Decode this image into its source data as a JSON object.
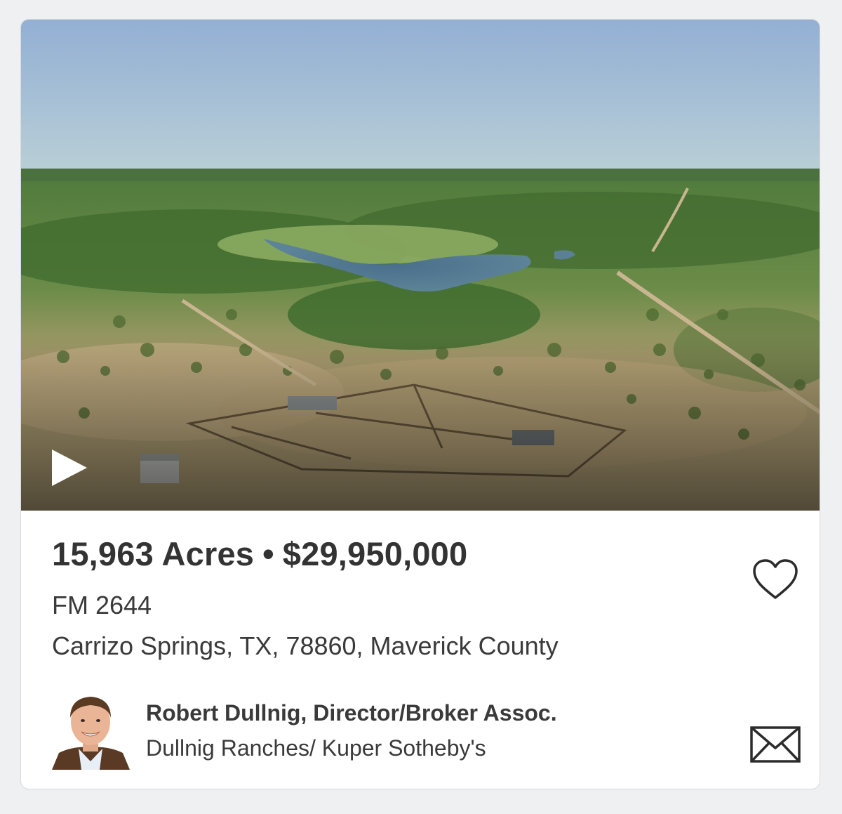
{
  "listing": {
    "acres": "15,963 Acres",
    "separator": "•",
    "price": "$29,950,000",
    "street": "FM 2644",
    "city_line": "Carrizo Springs, TX, 78860, Maverick County"
  },
  "agent": {
    "name": "Robert Dullnig, Director/Broker Assoc.",
    "company": "Dullnig Ranches/ Kuper Sotheby's"
  },
  "icons": {
    "play": "play-icon",
    "favorite": "heart-icon",
    "contact": "envelope-icon"
  },
  "colors": {
    "text": "#333333",
    "card_background": "#ffffff",
    "page_background": "#eff0f2"
  }
}
